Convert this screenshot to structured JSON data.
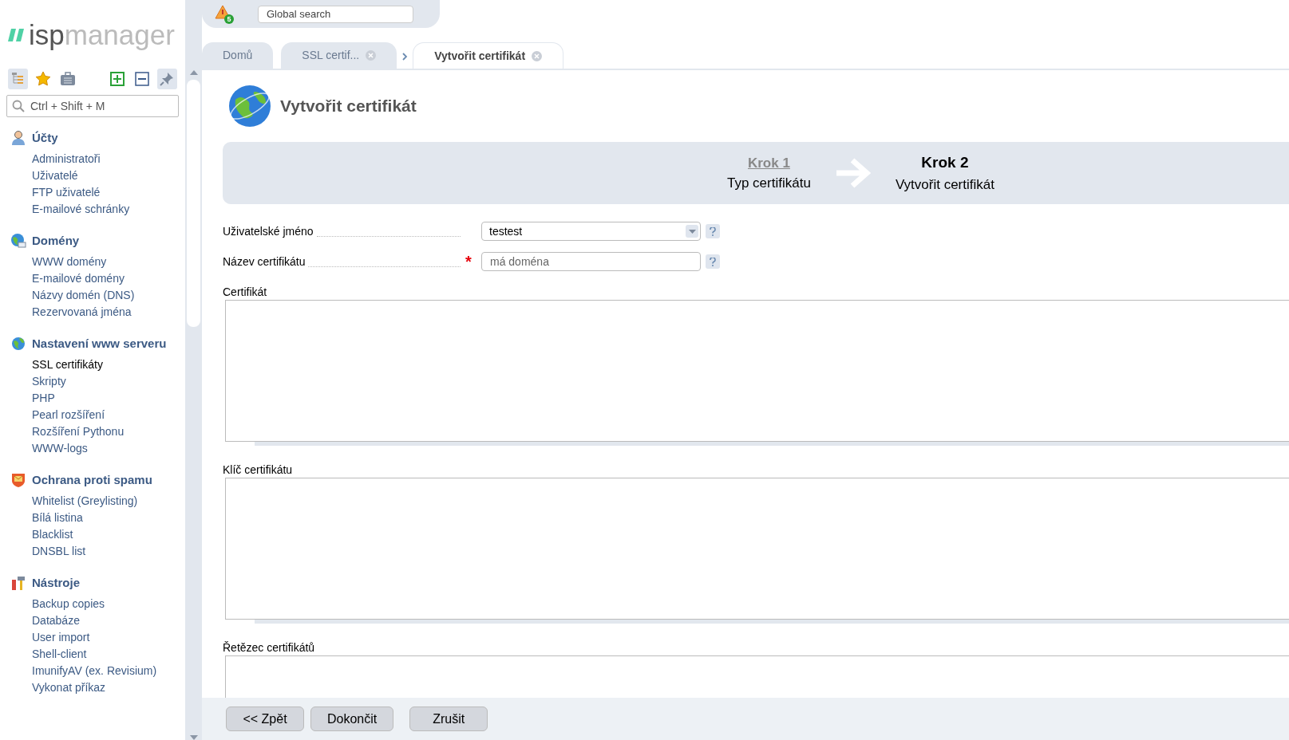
{
  "logo": {
    "part_1": "isp",
    "part_2": "manager"
  },
  "header": {
    "alert_count": "5",
    "search": {
      "placeholder": "Global search"
    }
  },
  "sidebar": {
    "toolbar": [
      {
        "kind": "tree",
        "selected": true
      },
      {
        "kind": "star",
        "selected": false
      },
      {
        "kind": "case",
        "selected": false
      },
      {
        "kind": "expand",
        "selected": false
      },
      {
        "kind": "collapse",
        "selected": false
      },
      {
        "kind": "pin",
        "selected": true
      }
    ],
    "search": {
      "placeholder": "Ctrl + Shift + M"
    },
    "sections": [
      {
        "kind": "users",
        "title": "Účty",
        "items": [
          {
            "label": "Administratoři",
            "selected": false
          },
          {
            "label": "Uživatelé",
            "selected": false
          },
          {
            "label": "FTP uživatelé",
            "selected": false
          },
          {
            "label": "E-mailové schránky",
            "selected": false
          }
        ]
      },
      {
        "kind": "domains",
        "title": "Domény",
        "items": [
          {
            "label": "WWW domény",
            "selected": false
          },
          {
            "label": "E-mailové domény",
            "selected": false
          },
          {
            "label": "Názvy domén (DNS)",
            "selected": false
          },
          {
            "label": "Rezervovaná jména",
            "selected": false
          }
        ]
      },
      {
        "kind": "globe",
        "title": "Nastavení www serveru",
        "items": [
          {
            "label": "SSL certifikáty",
            "selected": true
          },
          {
            "label": "Skripty",
            "selected": false
          },
          {
            "label": "PHP",
            "selected": false
          },
          {
            "label": "Pearl rozšíření",
            "selected": false
          },
          {
            "label": "Rozšíření Pythonu",
            "selected": false
          },
          {
            "label": "WWW-logs",
            "selected": false
          }
        ]
      },
      {
        "kind": "shield",
        "title": "Ochrana proti spamu",
        "items": [
          {
            "label": "Whitelist (Greylisting)",
            "selected": false
          },
          {
            "label": "Bílá listina",
            "selected": false
          },
          {
            "label": "Blacklist",
            "selected": false
          },
          {
            "label": "DNSBL list",
            "selected": false
          }
        ]
      },
      {
        "kind": "tools",
        "title": "Nástroje",
        "items": [
          {
            "label": "Backup copies",
            "selected": false
          },
          {
            "label": "Databáze",
            "selected": false
          },
          {
            "label": "User import",
            "selected": false
          },
          {
            "label": "Shell-client",
            "selected": false
          },
          {
            "label": "ImunifyAV (ex. Revisium)",
            "selected": false
          },
          {
            "label": "Vykonat příkaz",
            "selected": false
          }
        ]
      }
    ]
  },
  "tabs": [
    {
      "label": "Domů",
      "selected": false,
      "closable": false
    },
    {
      "label": "SSL certif...",
      "selected": false,
      "closable": true
    },
    {
      "label": "Vytvořit certifikát",
      "selected": true,
      "closable": true
    }
  ],
  "page": {
    "title": "Vytvořit certifikát",
    "steps": [
      {
        "title": "Krok 1",
        "subtitle": "Typ certifikátu",
        "current": false
      },
      {
        "title": "Krok 2",
        "subtitle": "Vytvořit certifikát",
        "current": true
      }
    ],
    "fields": [
      {
        "kind": "select",
        "label": "Uživatelské jméno",
        "value": "testest"
      },
      {
        "kind": "input",
        "label": "Název certifikátu",
        "placeholder": "má doména",
        "required_mark": "*"
      }
    ],
    "textareas": [
      {
        "label": "Certifikát"
      },
      {
        "label": "Klíč certifikátu"
      },
      {
        "label": "Řetězec certifikátů"
      }
    ],
    "buttons": [
      "<< Zpět",
      "Dokončit",
      "Zrušit"
    ]
  }
}
